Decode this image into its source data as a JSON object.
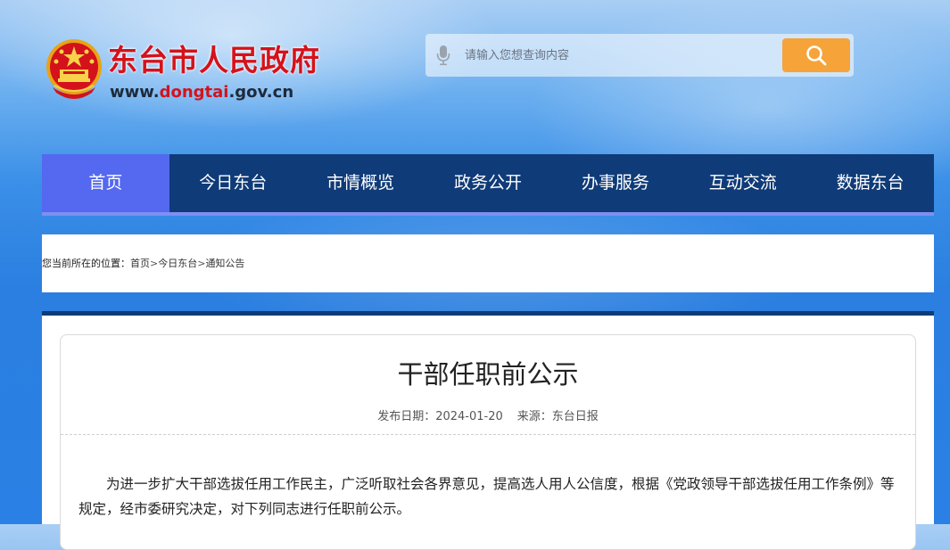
{
  "header": {
    "site_name": "东台市人民政府",
    "url_prefix": "www.",
    "url_accent": "dongtai",
    "url_suffix": ".gov.cn",
    "emblem_icon": "national-emblem-icon"
  },
  "search": {
    "placeholder": "请输入您想查询内容",
    "mic_icon": "microphone-icon",
    "button_icon": "search-icon",
    "button_color": "#f6a33a"
  },
  "nav": {
    "items": [
      {
        "label": "首页",
        "active": true
      },
      {
        "label": "今日东台"
      },
      {
        "label": "市情概览"
      },
      {
        "label": "政务公开"
      },
      {
        "label": "办事服务"
      },
      {
        "label": "互动交流"
      },
      {
        "label": "数据东台"
      }
    ],
    "background_color": "#0f3b78",
    "active_color": "#5468f0"
  },
  "breadcrumb": {
    "prefix": "您当前所在的位置：",
    "items": [
      "首页",
      "今日东台",
      "通知公告"
    ],
    "separator": ">"
  },
  "article": {
    "title": "干部任职前公示",
    "date_label": "发布日期：",
    "date": "2024-01-20",
    "source_label": "来源：",
    "source": "东台日报",
    "paragraph": "为进一步扩大干部选拔任用工作民主，广泛听取社会各界意见，提高选人用人公信度，根据《党政领导干部选拔任用工作条例》等规定，经市委研究决定，对下列同志进行任职前公示。"
  },
  "colors": {
    "brand_red": "#d4121b",
    "nav_navy": "#0f3b78"
  }
}
